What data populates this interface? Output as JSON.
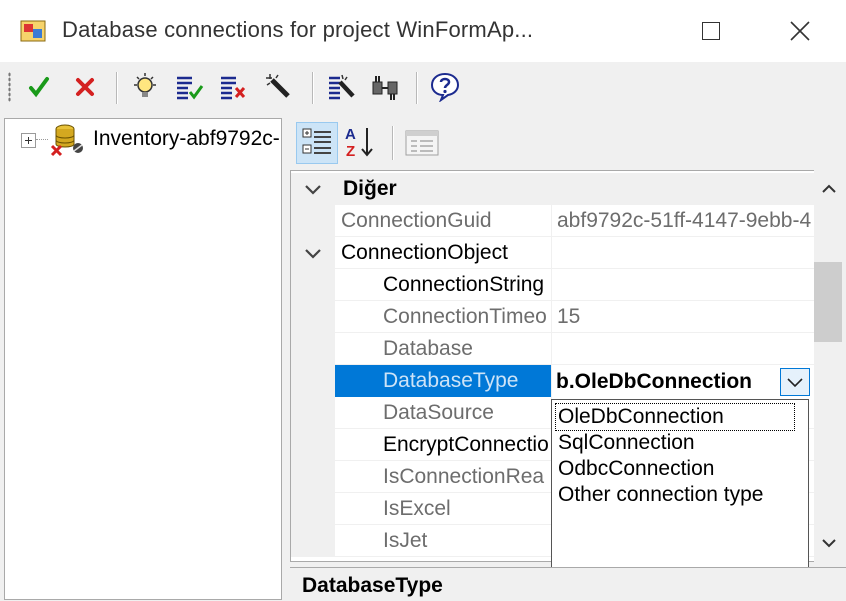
{
  "window": {
    "title": "Database connections for project WinFormAp...",
    "icon": "app-icon",
    "controls": [
      "maximize-icon",
      "close-icon"
    ]
  },
  "toolbar": {
    "buttons": [
      {
        "name": "accept-icon",
        "color": "#1a9a1a"
      },
      {
        "name": "cancel-icon",
        "color": "#d42020"
      },
      {
        "name": "bulb-icon"
      },
      {
        "name": "list-check-icon"
      },
      {
        "name": "list-delete-icon"
      },
      {
        "name": "wand-icon"
      },
      {
        "name": "list-wand-icon"
      },
      {
        "name": "connect-plug-icon"
      },
      {
        "name": "help-icon"
      }
    ]
  },
  "tree": {
    "items": [
      {
        "label": "Inventory-abf9792c-",
        "icon": "database-error-icon",
        "expanded": false
      }
    ]
  },
  "property_toolbar": {
    "categorized": {
      "icon": "categorized-icon",
      "active": true
    },
    "alphabetical": {
      "icon": "sort-az-icon"
    },
    "pages": {
      "icon": "property-pages-icon",
      "enabled": false
    }
  },
  "property_grid": {
    "category": "Diğer",
    "rows": {
      "connection_guid": {
        "name": "ConnectionGuid",
        "value": "abf9792c-51ff-4147-9ebb-4"
      },
      "connection_object": {
        "name": "ConnectionObject",
        "value": ""
      },
      "connection_string": {
        "name": "ConnectionString",
        "value": ""
      },
      "connection_timeout": {
        "name": "ConnectionTimeo",
        "value": "15"
      },
      "database": {
        "name": "Database",
        "value": ""
      },
      "database_type": {
        "name": "DatabaseType",
        "value": "b.OleDbConnection"
      },
      "data_source": {
        "name": "DataSource",
        "value": ""
      },
      "encrypt_connection": {
        "name": "EncryptConnectio",
        "value": ""
      },
      "is_connection_read": {
        "name": "IsConnectionRea",
        "value": ""
      },
      "is_excel": {
        "name": "IsExcel",
        "value": ""
      },
      "is_jet": {
        "name": "IsJet",
        "value": ""
      }
    },
    "selected_row": "DatabaseType"
  },
  "dropdown": {
    "options": [
      "OleDbConnection",
      "SqlConnection",
      "OdbcConnection",
      "Other connection type"
    ],
    "focused": "OleDbConnection"
  },
  "description": {
    "title": "DatabaseType"
  },
  "colors": {
    "selection": "#0078d7",
    "category_bg": "#f0f0f0",
    "muted_text": "#6d6d6d"
  }
}
